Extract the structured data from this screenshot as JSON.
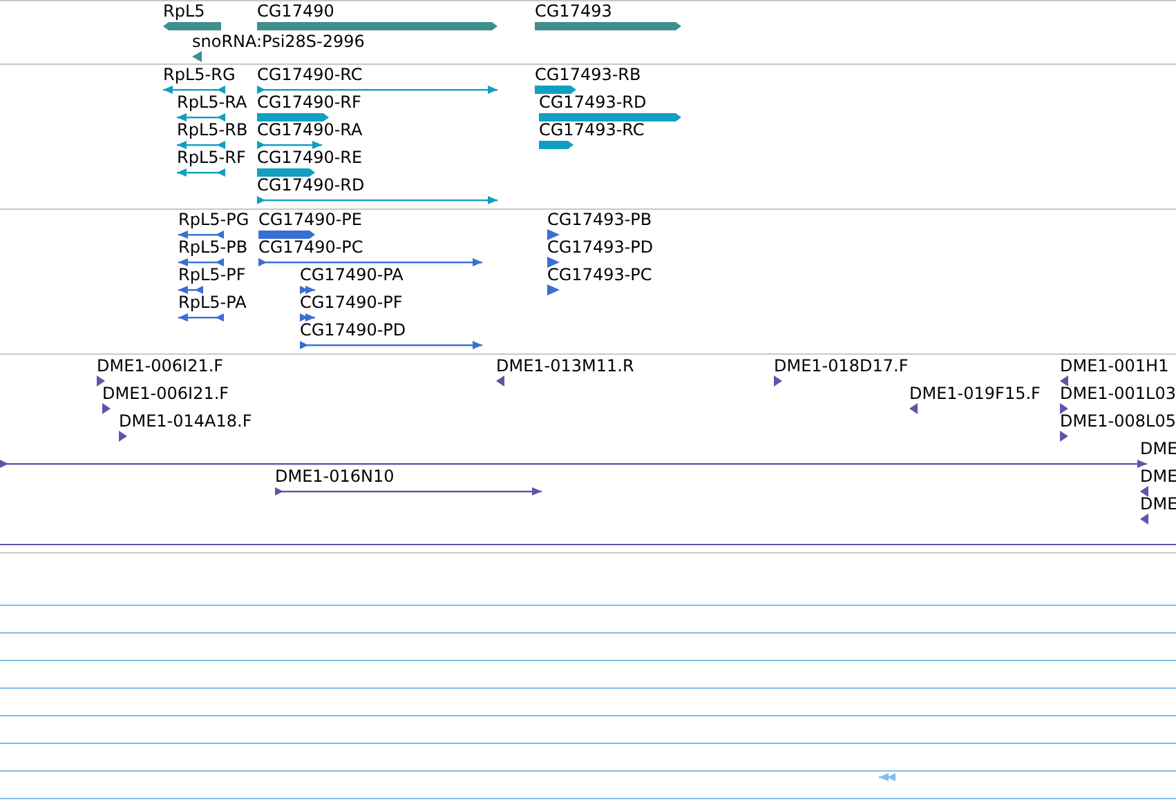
{
  "tracks": [
    {
      "kind": "gene",
      "features": [
        {
          "label": "RpL5",
          "reverse": true
        },
        {
          "label": "CG17490",
          "reverse": false
        },
        {
          "label": "CG17493",
          "reverse": false
        },
        {
          "label": "snoRNA:Psi28S-2996",
          "reverse": true
        }
      ]
    },
    {
      "kind": "transcript",
      "features": [
        {
          "label": "RpL5-RG",
          "reverse": true
        },
        {
          "label": "RpL5-RA",
          "reverse": true
        },
        {
          "label": "RpL5-RB",
          "reverse": true
        },
        {
          "label": "RpL5-RF",
          "reverse": true
        },
        {
          "label": "CG17490-RC",
          "reverse": false
        },
        {
          "label": "CG17490-RF",
          "reverse": false
        },
        {
          "label": "CG17490-RA",
          "reverse": false
        },
        {
          "label": "CG17490-RE",
          "reverse": false
        },
        {
          "label": "CG17490-RD",
          "reverse": false
        },
        {
          "label": "CG17493-RB",
          "reverse": false
        },
        {
          "label": "CG17493-RD",
          "reverse": false
        },
        {
          "label": "CG17493-RC",
          "reverse": false
        }
      ]
    },
    {
      "kind": "protein",
      "features": [
        {
          "label": "RpL5-PG",
          "reverse": true
        },
        {
          "label": "RpL5-PB",
          "reverse": true
        },
        {
          "label": "RpL5-PF",
          "reverse": true
        },
        {
          "label": "RpL5-PA",
          "reverse": true
        },
        {
          "label": "CG17490-PE",
          "reverse": false
        },
        {
          "label": "CG17490-PC",
          "reverse": false
        },
        {
          "label": "CG17490-PA",
          "reverse": false
        },
        {
          "label": "CG17490-PF",
          "reverse": false
        },
        {
          "label": "CG17490-PD",
          "reverse": false
        },
        {
          "label": "CG17493-PB",
          "reverse": false
        },
        {
          "label": "CG17493-PD",
          "reverse": false
        },
        {
          "label": "CG17493-PC",
          "reverse": false
        }
      ]
    },
    {
      "kind": "clone",
      "features": [
        {
          "label": "DME1-006I21.F",
          "reverse": false
        },
        {
          "label": "DME1-006I21.F",
          "reverse": false
        },
        {
          "label": "DME1-014A18.F",
          "reverse": false
        },
        {
          "label": "DME1-013M11.R",
          "reverse": true
        },
        {
          "label": "DME1-018D17.F",
          "reverse": false
        },
        {
          "label": "DME1-019F15.F",
          "reverse": true
        },
        {
          "label": "DME1-001H1",
          "reverse": true
        },
        {
          "label": "DME1-001L03",
          "reverse": false
        },
        {
          "label": "DME1-008L05",
          "reverse": false
        },
        {
          "label": "DME",
          "reverse": false
        },
        {
          "label": "DME",
          "reverse": true
        },
        {
          "label": "DME",
          "reverse": true
        },
        {
          "label": "DME1-016N10",
          "reverse": false
        }
      ]
    },
    {
      "kind": "empty",
      "features": [
        {
          "reverse": true
        }
      ]
    }
  ]
}
